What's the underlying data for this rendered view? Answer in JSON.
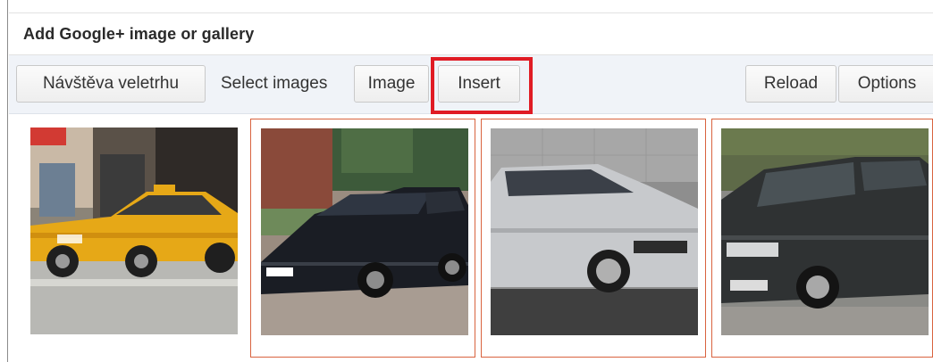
{
  "dialog": {
    "title": "Add Google+ image or gallery"
  },
  "toolbar": {
    "album_label": "Návštěva veletrhu",
    "select_images_label": "Select images",
    "image_label": "Image",
    "insert_label": "Insert",
    "reload_label": "Reload",
    "options_label": "Options"
  },
  "images": [
    {
      "subject": "yellow taxi",
      "selected": false
    },
    {
      "subject": "black station wagon",
      "selected": true
    },
    {
      "subject": "silver hatchback",
      "selected": true
    },
    {
      "subject": "dark gray station wagon",
      "selected": true
    }
  ],
  "colors": {
    "highlight": "#e01b24",
    "selection_border": "#d9633f",
    "toolbar_bg": "#f0f3f8"
  }
}
